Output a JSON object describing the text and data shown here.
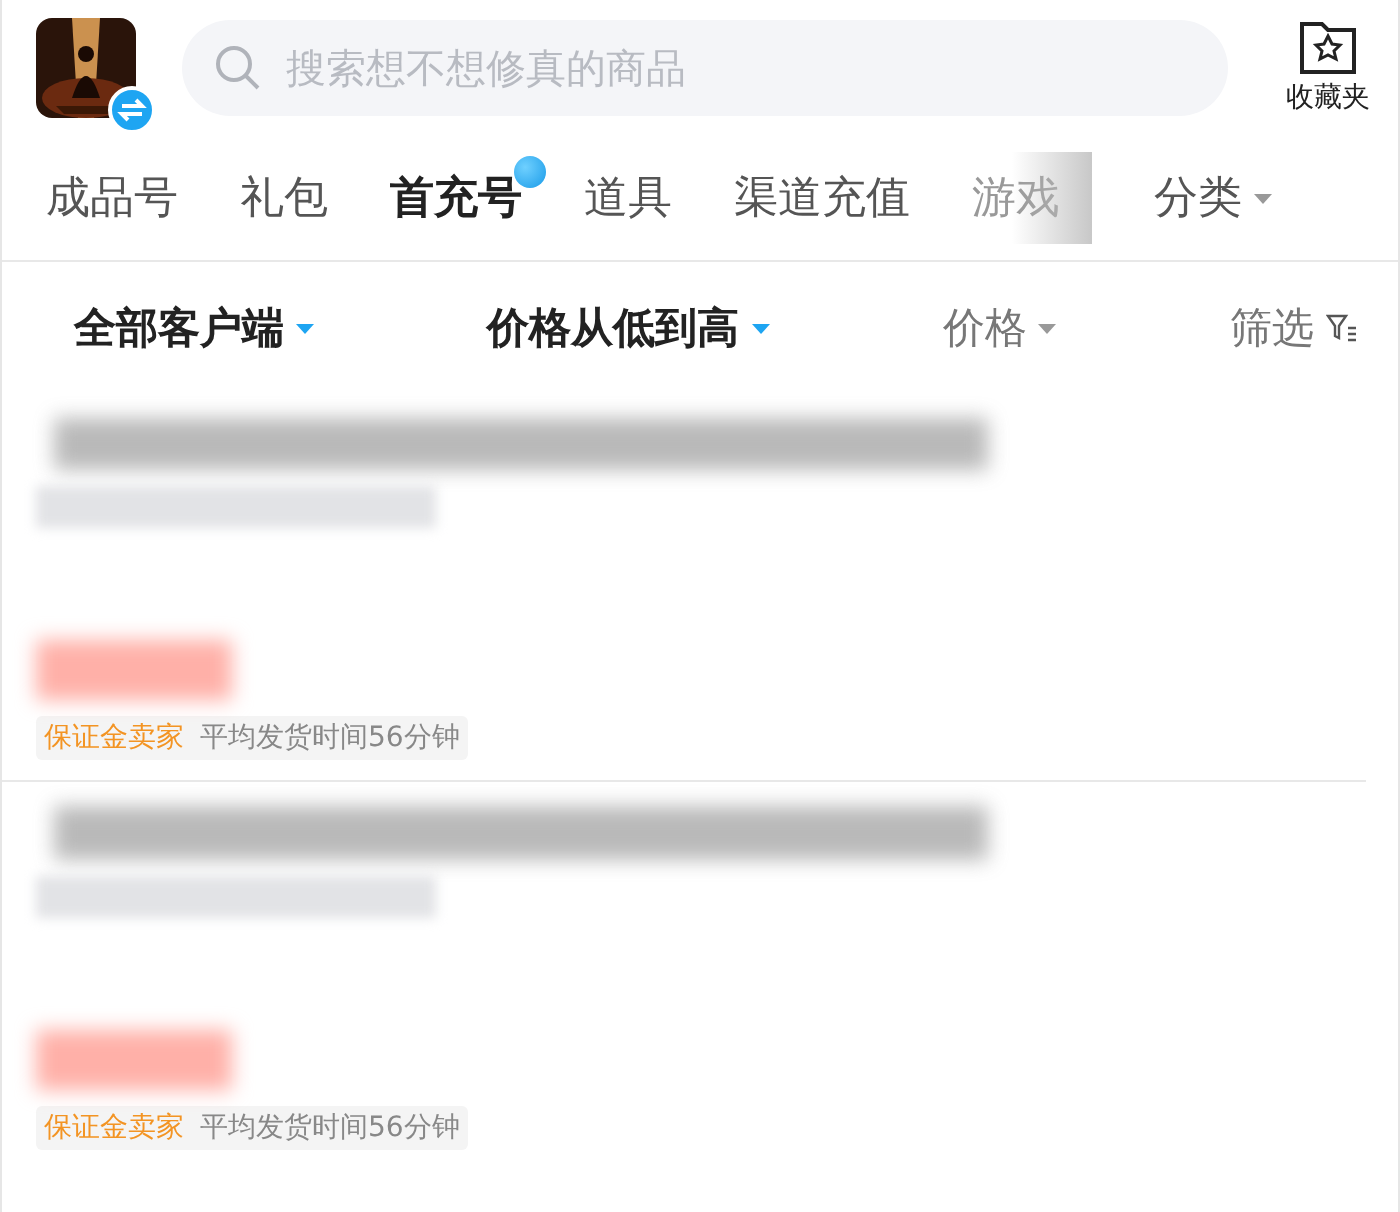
{
  "header": {
    "search": {
      "placeholder": "搜索想不想修真的商品"
    },
    "favorites": {
      "label": "收藏夹"
    }
  },
  "tabs": [
    {
      "label": "成品号",
      "selected": false,
      "badge": false,
      "faded": false
    },
    {
      "label": "礼包",
      "selected": false,
      "badge": false,
      "faded": false
    },
    {
      "label": "首充号",
      "selected": true,
      "badge": true,
      "faded": false
    },
    {
      "label": "道具",
      "selected": false,
      "badge": false,
      "faded": false
    },
    {
      "label": "渠道充值",
      "selected": false,
      "badge": false,
      "faded": false
    },
    {
      "label": "游戏",
      "selected": false,
      "badge": false,
      "faded": true
    }
  ],
  "category_menu": {
    "label": "分类"
  },
  "filters": [
    {
      "label": "全部客户端",
      "kind": "dropdown",
      "active": true
    },
    {
      "label": "价格从低到高",
      "kind": "dropdown",
      "active": true
    },
    {
      "label": "价格",
      "kind": "dropdown",
      "active": false
    },
    {
      "label": "筛选",
      "kind": "filter",
      "active": false
    }
  ],
  "listings": [
    {
      "tags": [
        {
          "label": "保证金卖家",
          "kind": "seller"
        },
        {
          "label": "平均发货时间56分钟",
          "kind": "info"
        }
      ]
    },
    {
      "tags": [
        {
          "label": "保证金卖家",
          "kind": "seller"
        },
        {
          "label": "平均发货时间56分钟",
          "kind": "info"
        }
      ]
    }
  ]
}
